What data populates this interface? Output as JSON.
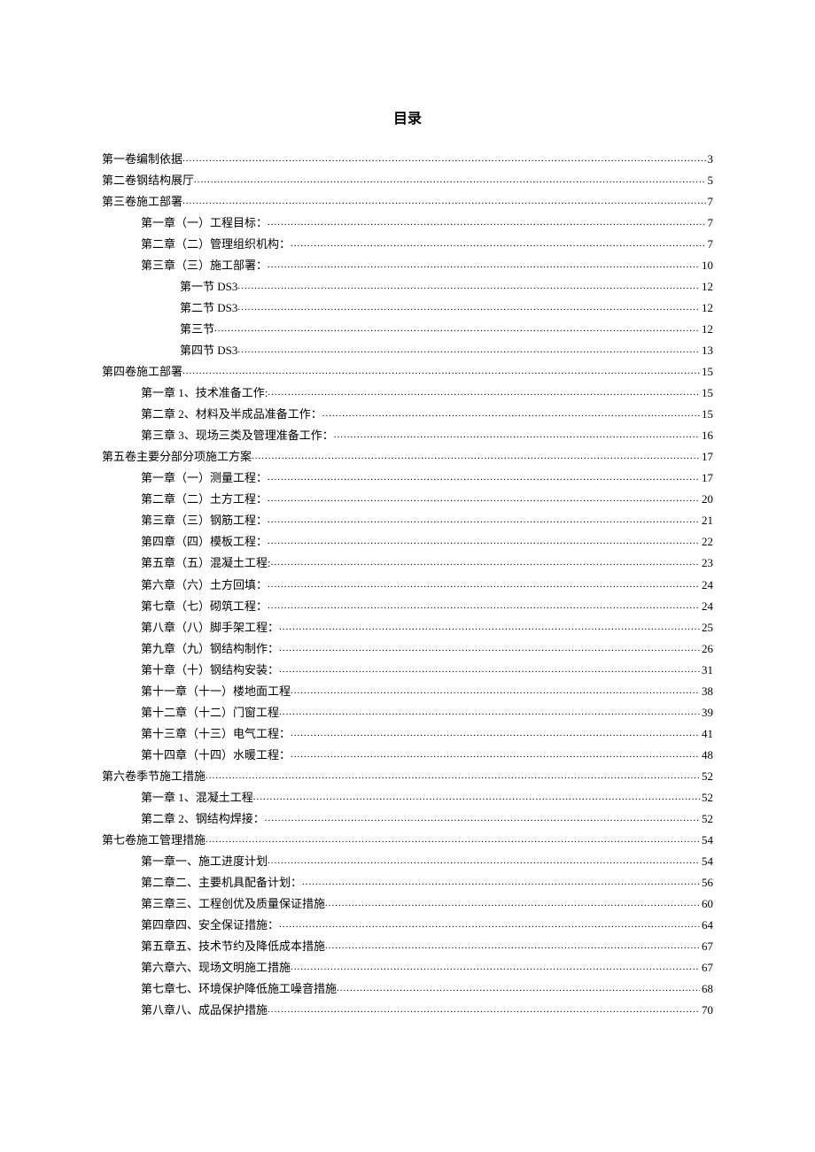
{
  "title": "目录",
  "toc": [
    {
      "level": 0,
      "label": "第一卷编制依据",
      "page": "3"
    },
    {
      "level": 0,
      "label": "第二卷钢结构展厅",
      "page": "5"
    },
    {
      "level": 0,
      "label": "第三卷施工部署",
      "page": "7"
    },
    {
      "level": 1,
      "label": "第一章（一）工程目标：",
      "page": "7"
    },
    {
      "level": 1,
      "label": "第二章（二）管理组织机构：",
      "page": "7"
    },
    {
      "level": 1,
      "label": "第三章（三）施工部署：",
      "page": "10"
    },
    {
      "level": 2,
      "label": "第一节 DS3",
      "page": "12"
    },
    {
      "level": 2,
      "label": "第二节 DS3",
      "page": "12"
    },
    {
      "level": 2,
      "label": "第三节",
      "page": "12"
    },
    {
      "level": 2,
      "label": "第四节 DS3",
      "page": "13"
    },
    {
      "level": 0,
      "label": "第四卷施工部署",
      "page": "15"
    },
    {
      "level": 1,
      "label": "第一章 1、技术准备工作:",
      "page": "15"
    },
    {
      "level": 1,
      "label": "第二章 2、材料及半成品准备工作：",
      "page": "15"
    },
    {
      "level": 1,
      "label": "第三章 3、现场三类及管理准备工作：",
      "page": "16"
    },
    {
      "level": 0,
      "label": "第五卷主要分部分项施工方案",
      "page": "17"
    },
    {
      "level": 1,
      "label": "第一章（一）测量工程：",
      "page": "17"
    },
    {
      "level": 1,
      "label": "第二章（二）土方工程：",
      "page": "20"
    },
    {
      "level": 1,
      "label": "第三章（三）钢筋工程：",
      "page": "21"
    },
    {
      "level": 1,
      "label": "第四章（四）模板工程：",
      "page": "22"
    },
    {
      "level": 1,
      "label": "第五章（五）混凝土工程:",
      "page": "23"
    },
    {
      "level": 1,
      "label": "第六章（六）土方回填：",
      "page": "24"
    },
    {
      "level": 1,
      "label": "第七章（七）砌筑工程：",
      "page": "24"
    },
    {
      "level": 1,
      "label": "第八章（八）脚手架工程：",
      "page": "25"
    },
    {
      "level": 1,
      "label": "第九章（九）钢结构制作：",
      "page": "26"
    },
    {
      "level": 1,
      "label": "第十章（十）钢结构安装：",
      "page": "31"
    },
    {
      "level": 1,
      "label": "第十一章（十一）楼地面工程",
      "page": "38"
    },
    {
      "level": 1,
      "label": "第十二章（十二）门窗工程",
      "page": "39"
    },
    {
      "level": 1,
      "label": "第十三章（十三）电气工程：",
      "page": "41"
    },
    {
      "level": 1,
      "label": "第十四章（十四）水暖工程：",
      "page": "48"
    },
    {
      "level": 0,
      "label": "第六卷季节施工措施",
      "page": "52"
    },
    {
      "level": 1,
      "label": "第一章 1、混凝土工程",
      "page": "52"
    },
    {
      "level": 1,
      "label": "第二章 2、钢结构焊接：",
      "page": "52"
    },
    {
      "level": 0,
      "label": "第七卷施工管理措施",
      "page": "54"
    },
    {
      "level": 1,
      "label": "第一章一、施工进度计划",
      "page": "54"
    },
    {
      "level": 1,
      "label": "第二章二、主要机具配备计划：",
      "page": "56"
    },
    {
      "level": 1,
      "label": "第三章三、工程创优及质量保证措施",
      "page": "60"
    },
    {
      "level": 1,
      "label": "第四章四、安全保证措施：",
      "page": "64"
    },
    {
      "level": 1,
      "label": "第五章五、技术节约及降低成本措施",
      "page": "67"
    },
    {
      "level": 1,
      "label": "第六章六、现场文明施工措施",
      "page": "67"
    },
    {
      "level": 1,
      "label": "第七章七、环境保护降低施工噪音措施",
      "page": "68"
    },
    {
      "level": 1,
      "label": "第八章八、成品保护措施",
      "page": "70"
    }
  ]
}
